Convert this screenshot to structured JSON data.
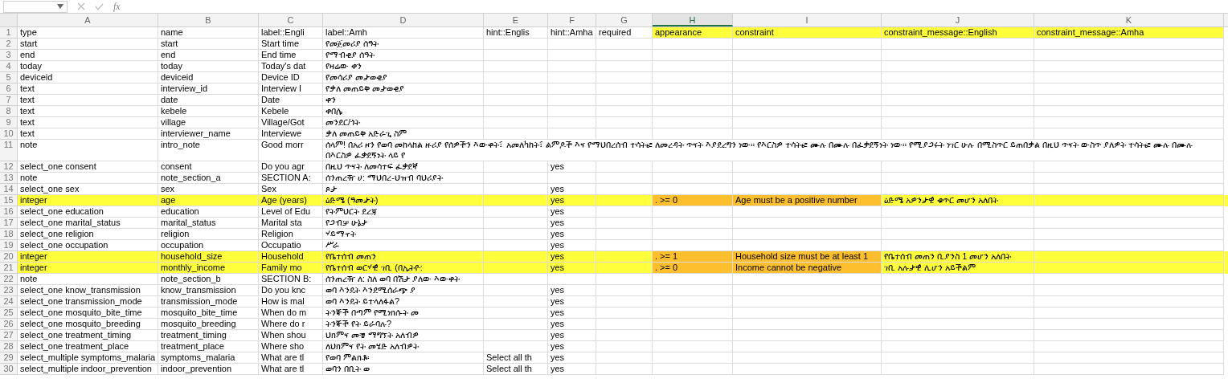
{
  "formula_bar": {
    "function_label": "fx"
  },
  "columns": [
    {
      "label": "A",
      "selected": false
    },
    {
      "label": "B",
      "selected": false
    },
    {
      "label": "C",
      "selected": false
    },
    {
      "label": "D",
      "selected": false
    },
    {
      "label": "E",
      "selected": false
    },
    {
      "label": "F",
      "selected": false
    },
    {
      "label": "G",
      "selected": false
    },
    {
      "label": "H",
      "selected": true
    },
    {
      "label": "I",
      "selected": false
    },
    {
      "label": "J",
      "selected": false
    },
    {
      "label": "K",
      "selected": false
    }
  ],
  "rows": [
    {
      "number": "1",
      "cells": [
        "type",
        "name",
        "label::Engli",
        "label::Amh",
        "hint::Englis",
        "hint::Amha",
        "required",
        {
          "text": "appearance",
          "color": "#ffff3b"
        },
        {
          "text": "constraint",
          "color": "#ffff3b"
        },
        {
          "text": "constraint_message::English",
          "color": "#ffff3b"
        },
        {
          "text": "constraint_message::Amha",
          "color": "#ffff3b"
        }
      ]
    },
    {
      "number": "2",
      "cells": [
        "start",
        "start",
        "Start time",
        "የመጀመሪያ ሰዓት"
      ]
    },
    {
      "number": "3",
      "cells": [
        "end",
        "end",
        "End time",
        "የማብቂያ ሰዓት"
      ]
    },
    {
      "number": "4",
      "cells": [
        "today",
        "today",
        "Today's dat",
        "የዛሬው ቀን"
      ]
    },
    {
      "number": "5",
      "cells": [
        "deviceid",
        "deviceid",
        "Device ID",
        "የመሳሪያ መታወቂያ"
      ]
    },
    {
      "number": "6",
      "cells": [
        "text",
        "interview_id",
        "Interview I",
        "የቃለ መጠይቅ መታወቂያ"
      ]
    },
    {
      "number": "7",
      "cells": [
        "text",
        "date",
        "Date",
        "ቀን"
      ]
    },
    {
      "number": "8",
      "cells": [
        "text",
        "kebele",
        "Kebele",
        "ቀበሌ"
      ]
    },
    {
      "number": "9",
      "cells": [
        "text",
        "village",
        "Village/Got",
        "መንደር/ጎት"
      ]
    },
    {
      "number": "10",
      "cells": [
        "text",
        "interviewer_name",
        "Interviewe",
        "ቃለ መጠይቅ አድራጊ ስም"
      ]
    },
    {
      "number": "11",
      "cells": [
        "note",
        "intro_note",
        "Good morr",
        "ሰላም! በአሪ ዞን የወባ መከላከል ዙሪያ የሰዎችን እውቀት፣ አመለካከት፣ ልምዶች እና የማህበረሰብ ተሳትፎ ለመረዳት ጥናት እያደረግን ነው። የእርስዎ ተሳትፎ ሙሉ በሙሉ በፈቃደኝነት ነው። የሚያጋሩት ነገር ሁሉ በሚስጥር ይጠበቃል በዚህ ጥናት ውስጥ ያለዎት ተሳትፎ ሙሉ በሙሉ በእርስዎ ፈቃደኝነት ላይ የ"
      ]
    },
    {
      "number": "12",
      "cells": [
        "select_one consent",
        "consent",
        "Do you agr",
        "በዚህ ጥናት ለመሳተፍ ፈቃደኛ",
        "",
        "yes"
      ]
    },
    {
      "number": "13",
      "cells": [
        "note",
        "note_section_a",
        "SECTION A:",
        "ሰንጠረዥ ሀ: ማህበረ-ህዝብ ባህሪያት"
      ]
    },
    {
      "number": "14",
      "cells": [
        "select_one sex",
        "sex",
        "Sex",
        "ጾታ",
        "",
        "yes"
      ]
    },
    {
      "number": "15",
      "color": "#ffff3b",
      "cells": [
        "integer",
        "age",
        "Age (years)",
        "ዕድሜ (ዓመታት)",
        "",
        "yes",
        "",
        {
          "text": ". >= 0",
          "color": "#fdbf2d"
        },
        {
          "text": "Age must be a positive number",
          "color": "#fdbf2d"
        },
        "ዕድሜ አዎንታዊ ቁጥር መሆን አለበት"
      ]
    },
    {
      "number": "16",
      "cells": [
        "select_one education",
        "education",
        "Level of Edu",
        "የትምህርት ደረጃ",
        "",
        "yes"
      ]
    },
    {
      "number": "17",
      "cells": [
        "select_one marital_status",
        "marital_status",
        "Marital sta",
        "የጋብቻ ሁኔታ",
        "",
        "yes"
      ]
    },
    {
      "number": "18",
      "cells": [
        "select_one religion",
        "religion",
        "Religion",
        "ሃይማኖት",
        "",
        "yes"
      ]
    },
    {
      "number": "19",
      "cells": [
        "select_one occupation",
        "occupation",
        "Occupatio",
        "ሥራ",
        "",
        "yes"
      ]
    },
    {
      "number": "20",
      "color": "#ffff3b",
      "cells": [
        "integer",
        "household_size",
        "Household",
        "የቤተሰብ መጠን",
        "",
        "yes",
        "",
        {
          "text": ". >= 1",
          "color": "#fdbf2d"
        },
        {
          "text": "Household size must be at least 1",
          "color": "#fdbf2d"
        },
        "የቤተሰብ መጠን ቢያንስ 1 መሆን አለበት"
      ]
    },
    {
      "number": "21",
      "color": "#ffff3b",
      "cells": [
        "integer",
        "monthly_income",
        "Family mo",
        "የቤተሰብ ወርሃዊ ገቢ (በኢትዮ:",
        "",
        "yes",
        "",
        {
          "text": ". >= 0",
          "color": "#fdbf2d"
        },
        {
          "text": "Income cannot be negative",
          "color": "#fdbf2d"
        },
        "ገቢ አሉታዊ ሊሆን አይችልም"
      ]
    },
    {
      "number": "22",
      "cells": [
        "note",
        "note_section_b",
        "SECTION B:",
        "ሰንጠረዥ ለ: ስለ ወባ በሽታ ያለው እውቀት"
      ]
    },
    {
      "number": "23",
      "cells": [
        "select_one know_transmission",
        "know_transmission",
        "Do you knc",
        "ወባ እንዴት እንደሚሰራጭ ያ",
        "",
        "yes"
      ]
    },
    {
      "number": "24",
      "cells": [
        "select_one transmission_mode",
        "transmission_mode",
        "How is mal",
        "ወባ እንዴት ይተላለፋል?",
        "",
        "yes"
      ]
    },
    {
      "number": "25",
      "cells": [
        "select_one mosquito_bite_time",
        "mosquito_bite_time",
        "When do m",
        "ትንኞች በጣም የሚነክሱት መ",
        "",
        "yes"
      ]
    },
    {
      "number": "26",
      "cells": [
        "select_one mosquito_breeding",
        "mosquito_breeding",
        "Where do r",
        "ትንኞች የት ይራባሉ?",
        "",
        "yes"
      ]
    },
    {
      "number": "27",
      "cells": [
        "select_one treatment_timing",
        "treatment_timing",
        "When shou",
        "ህክምና መቼ ማግኘት አለብዎ",
        "",
        "yes"
      ]
    },
    {
      "number": "28",
      "cells": [
        "select_one treatment_place",
        "treatment_place",
        "Where sho",
        "ለህክምና የት መሄድ አለብዎት",
        "",
        "yes"
      ]
    },
    {
      "number": "29",
      "cells": [
        "select_multiple symptoms_malaria",
        "symptoms_malaria",
        "What are tl",
        "የወባ ምልክቶ፡",
        "Select all th",
        "yes"
      ]
    },
    {
      "number": "30",
      "cells": [
        "select_multiple indoor_prevention",
        "indoor_prevention",
        "What are tl",
        "ወባን በቢት ወ",
        "Select all th",
        "yes"
      ]
    }
  ]
}
